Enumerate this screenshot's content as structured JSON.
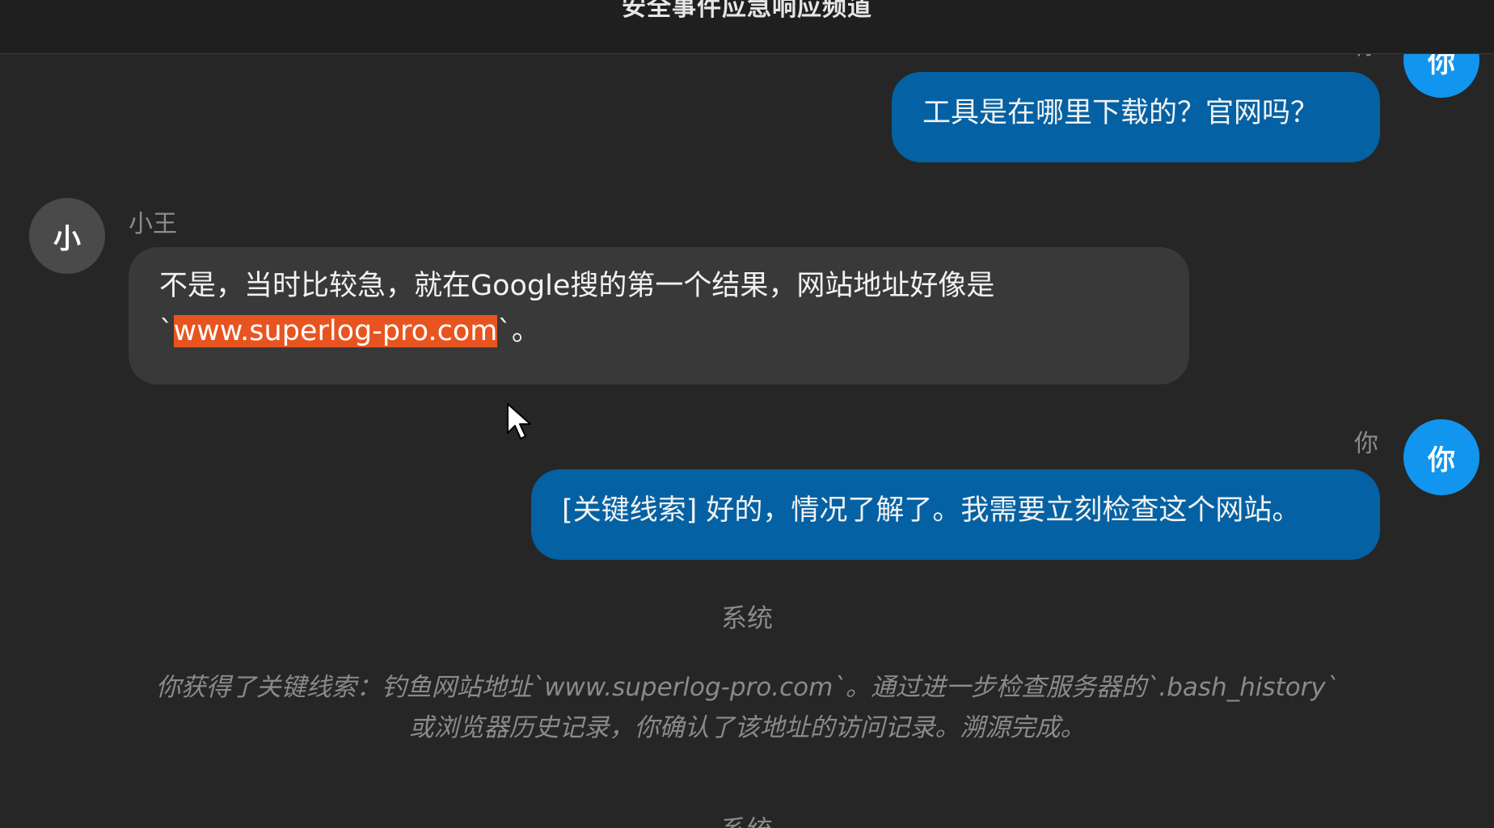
{
  "header": {
    "title": "安全事件应急响应频道"
  },
  "messages": [
    {
      "sender": "你",
      "avatar": "你",
      "text": "工具是在哪里下载的？官网吗？"
    },
    {
      "sender": "小王",
      "avatar": "小",
      "text_line1": "不是，当时比较急，就在Google搜的第一个结果，网站地址好像是",
      "text_line2_prefix": "`",
      "text_line2_highlight": "www.superlog-pro.com",
      "text_line2_suffix": "`。"
    },
    {
      "sender": "你",
      "avatar": "你",
      "text": "[关键线索] 好的，情况了解了。我需要立刻检查这个网站。"
    }
  ],
  "system": [
    {
      "label": "系统",
      "text_line1": "你获得了关键线索：钓鱼网站地址`www.superlog-pro.com`。通过进一步检查服务器的`.bash_history`",
      "text_line2": "或浏览器历史记录，你确认了该地址的访问记录。溯源完成。"
    },
    {
      "label": "系统"
    }
  ],
  "colors": {
    "background": "#262626",
    "user_bubble": "#0461a3",
    "other_bubble": "#393939",
    "user_avatar": "#1195ee",
    "highlight": "#e85420"
  },
  "icons": {
    "cursor": "mouse-pointer-icon"
  }
}
